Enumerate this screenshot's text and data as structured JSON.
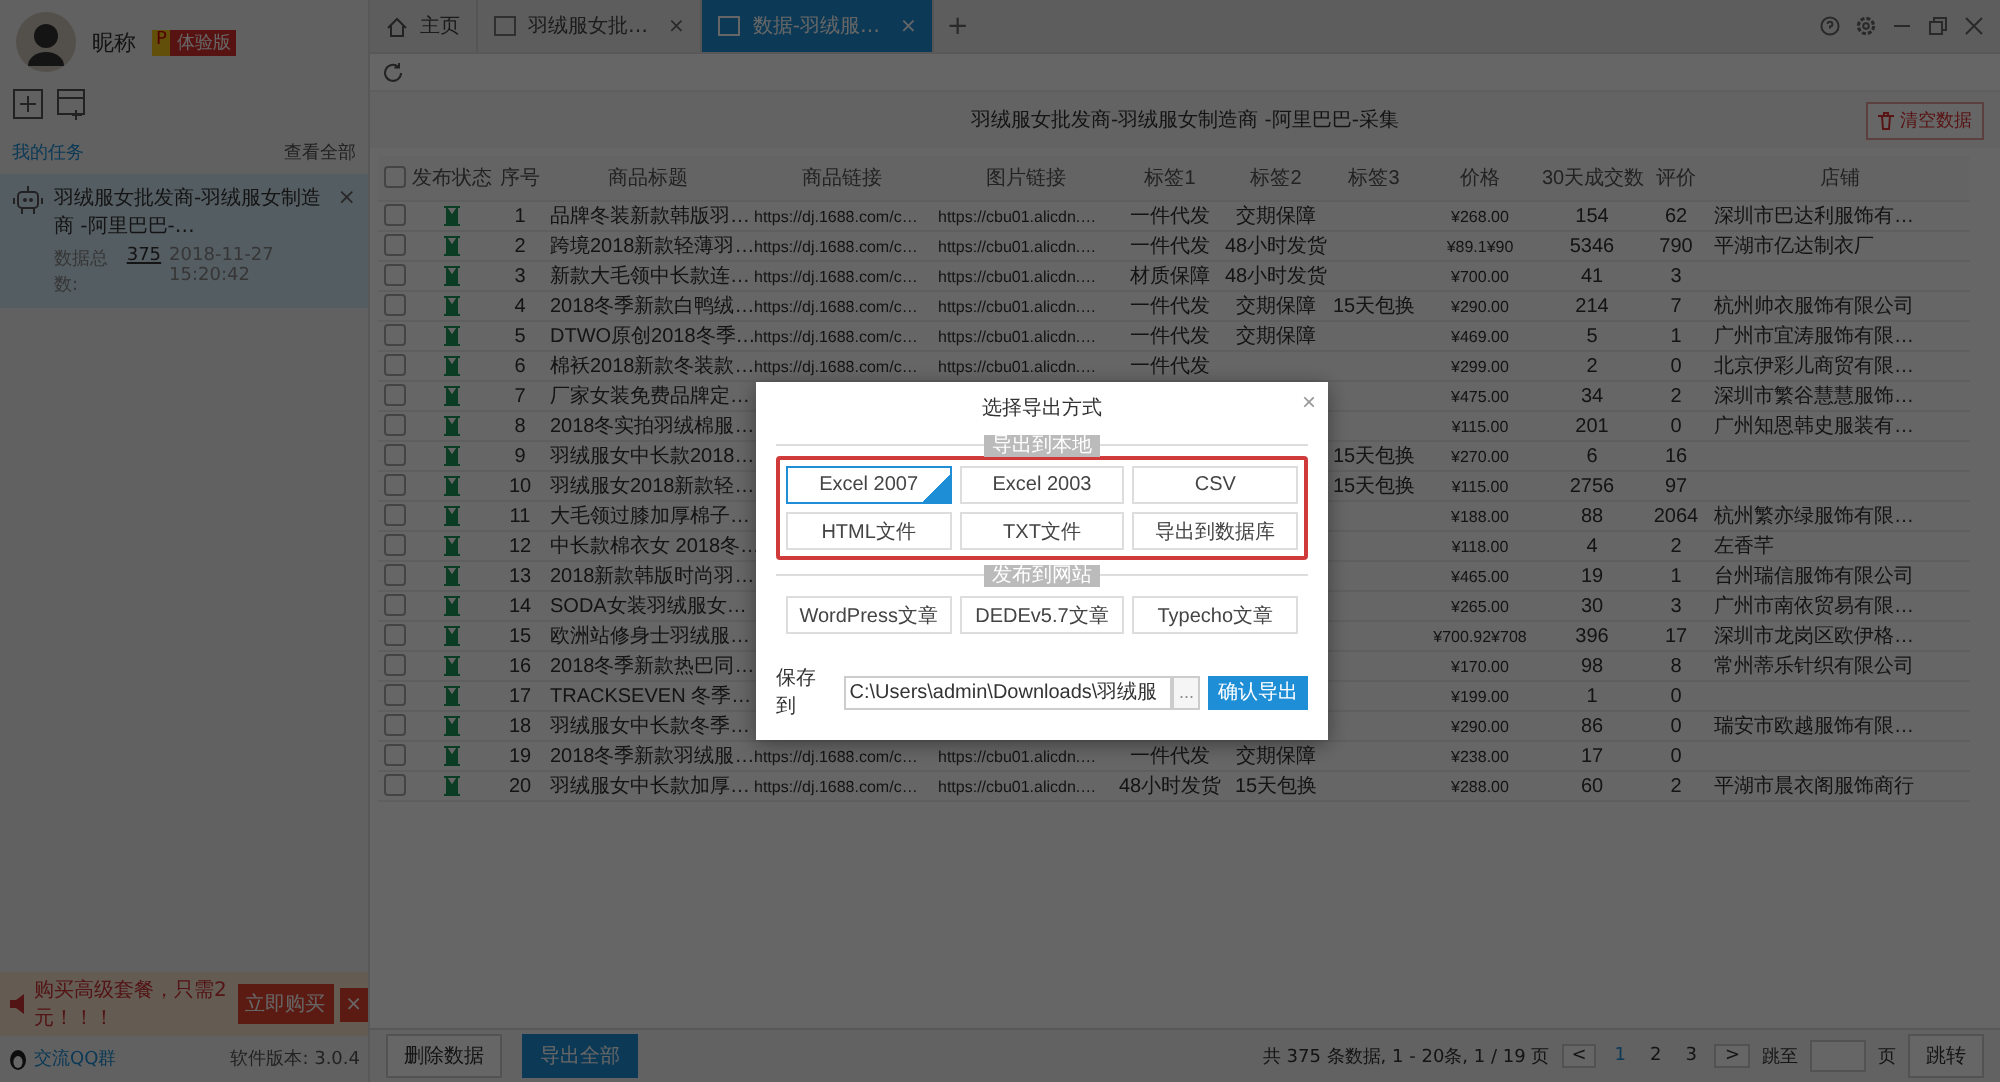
{
  "user": {
    "nickname": "昵称",
    "badge_letter": "P",
    "badge": "体验版"
  },
  "sidebar": {
    "section_title": "我的任务",
    "view_all": "查看全部",
    "tasks": [
      {
        "title": "羽绒服女批发商-羽绒服女制造商 -阿里巴巴-…",
        "count_label": "数据总数:",
        "count": "375",
        "time": "2018-11-27 15:20:42",
        "close": "×",
        "selected": true
      }
    ],
    "promo": {
      "text": "购买高级套餐，只需2元！！！",
      "button": "立即购买",
      "close": "×"
    },
    "qq_link": "交流QQ群",
    "version": "软件版本: 3.0.4"
  },
  "tabs": [
    {
      "kind": "home",
      "label": "主页",
      "selected": false
    },
    {
      "kind": "page",
      "label": "羽绒服女批…",
      "close": "×",
      "selected": false
    },
    {
      "kind": "page",
      "label": "数据-羽绒服…",
      "close": "×",
      "selected": true
    }
  ],
  "add_tab": "+",
  "page": {
    "title": "羽绒服女批发商-羽绒服女制造商 -阿里巴巴-采集",
    "clear_button": "清空数据"
  },
  "table": {
    "all_checked": false,
    "columns": [
      "发布状态",
      "序号",
      "商品标题",
      "商品链接",
      "图片链接",
      "标签1",
      "标签2",
      "标签3",
      "价格",
      "30天成交数",
      "评价",
      "店铺"
    ],
    "rows": [
      {
        "checked": false,
        "index": "1",
        "title": "品牌冬装新款韩版羽…",
        "link": "https://dj.1688.com/c…",
        "image": "https://cbu01.alicdn.…",
        "tag1": "一件代发",
        "tag2": "交期保障",
        "price": "¥268.00",
        "sales": "154",
        "rating": "62",
        "shop": "深圳市巴达利服饰有…"
      },
      {
        "checked": false,
        "index": "2",
        "title": "跨境2018新款轻薄羽…",
        "link": "https://dj.1688.com/c…",
        "image": "https://cbu01.alicdn.…",
        "tag1": "一件代发",
        "tag2": "48小时发货",
        "price": "¥89.1¥90",
        "sales": "5346",
        "rating": "790",
        "shop": "平湖市亿达制衣厂"
      },
      {
        "checked": false,
        "index": "3",
        "title": "新款大毛领中长款连…",
        "link": "https://dj.1688.com/c…",
        "image": "https://cbu01.alicdn.…",
        "tag1": "材质保障",
        "tag2": "48小时发货",
        "price": "¥700.00",
        "sales": "41",
        "rating": "3"
      },
      {
        "checked": false,
        "index": "4",
        "title": "2018冬季新款白鸭绒…",
        "link": "https://dj.1688.com/c…",
        "image": "https://cbu01.alicdn.…",
        "tag1": "一件代发",
        "tag2": "交期保障",
        "tag3": "15天包换",
        "price": "¥290.00",
        "sales": "214",
        "rating": "7",
        "shop": "杭州帅衣服饰有限公司"
      },
      {
        "checked": false,
        "index": "5",
        "title": "DTWO原创2018冬季…",
        "link": "https://dj.1688.com/c…",
        "image": "https://cbu01.alicdn.…",
        "tag1": "一件代发",
        "tag2": "交期保障",
        "price": "¥469.00",
        "sales": "5",
        "rating": "1",
        "shop": "广州市宜涛服饰有限…"
      },
      {
        "checked": false,
        "index": "6",
        "title": "棉袄2018新款冬装款…",
        "link": "https://dj.1688.com/c…",
        "image": "https://cbu01.alicdn.…",
        "tag1": "一件代发",
        "price": "¥299.00",
        "sales": "2",
        "rating": "0",
        "shop": "北京伊彩儿商贸有限…"
      },
      {
        "checked": false,
        "index": "7",
        "title": "厂家女装免费品牌定…",
        "price": "¥475.00",
        "sales": "34",
        "rating": "2",
        "shop": "深圳市繁谷慧慧服饰…"
      },
      {
        "checked": false,
        "index": "8",
        "title": "2018冬实拍羽绒棉服…",
        "price": "¥115.00",
        "sales": "201",
        "rating": "0",
        "shop": "广州知恩韩史服装有…"
      },
      {
        "checked": false,
        "index": "9",
        "title": "羽绒服女中长款2018…",
        "tag3": "15天包换",
        "price": "¥270.00",
        "sales": "6",
        "rating": "16"
      },
      {
        "checked": false,
        "index": "10",
        "title": "羽绒服女2018新款轻…",
        "tag3": "15天包换",
        "price": "¥115.00",
        "sales": "2756",
        "rating": "97"
      },
      {
        "checked": false,
        "index": "11",
        "title": "大毛领过膝加厚棉子…",
        "price": "¥188.00",
        "sales": "88",
        "rating": "2064",
        "shop": "杭州繁亦绿服饰有限…"
      },
      {
        "checked": false,
        "index": "12",
        "title": "中长款棉衣女 2018冬…",
        "price": "¥118.00",
        "sales": "4",
        "rating": "2",
        "shop": "左香芊"
      },
      {
        "checked": false,
        "index": "13",
        "title": "2018新款韩版时尚羽…",
        "price": "¥465.00",
        "sales": "19",
        "rating": "1",
        "shop": "台州瑞信服饰有限公司"
      },
      {
        "checked": false,
        "index": "14",
        "title": "SODA女装羽绒服女…",
        "price": "¥265.00",
        "sales": "30",
        "rating": "3",
        "shop": "广州市南依贸易有限…"
      },
      {
        "checked": false,
        "index": "15",
        "title": "欧洲站修身士羽绒服…",
        "price": "¥700.92¥708",
        "sales": "396",
        "rating": "17",
        "shop": "深圳市龙岗区欧伊格…"
      },
      {
        "checked": false,
        "index": "16",
        "title": "2018冬季新款热巴同…",
        "price": "¥170.00",
        "sales": "98",
        "rating": "8",
        "shop": "常州蒂乐针织有限公司"
      },
      {
        "checked": false,
        "index": "17",
        "title": "TRACKSEVEN 冬季…",
        "price": "¥199.00",
        "sales": "1",
        "rating": "0"
      },
      {
        "checked": false,
        "index": "18",
        "title": "羽绒服女中长款冬季…",
        "price": "¥290.00",
        "sales": "86",
        "rating": "0",
        "shop": "瑞安市欧越服饰有限…"
      },
      {
        "checked": false,
        "index": "19",
        "title": "2018冬季新款羽绒服…",
        "link": "https://dj.1688.com/c…",
        "image": "https://cbu01.alicdn.…",
        "tag1": "一件代发",
        "tag2": "交期保障",
        "price": "¥238.00",
        "sales": "17",
        "rating": "0"
      },
      {
        "checked": false,
        "index": "20",
        "title": "羽绒服女中长款加厚…",
        "link": "https://dj.1688.com/c…",
        "image": "https://cbu01.alicdn.…",
        "tag1": "48小时发货",
        "tag2": "15天包换",
        "price": "¥288.00",
        "sales": "60",
        "rating": "2",
        "shop": "平湖市晨衣阁服饰商行"
      }
    ]
  },
  "footer_buttons": [
    {
      "label": "删除数据",
      "kind": "default"
    },
    {
      "label": "导出全部",
      "kind": "primary"
    }
  ],
  "pagination": {
    "summary": "共 375 条数据, 1 - 20条, 1 / 19 页",
    "prev": "<",
    "pages": [
      {
        "label": "1",
        "selected": true
      },
      {
        "label": "2",
        "selected": false
      },
      {
        "label": "3",
        "selected": false
      }
    ],
    "next": ">",
    "goto_label": "跳至",
    "page_suffix": "页",
    "goto_button": "跳转"
  },
  "dialog": {
    "title": "选择导出方式",
    "close": "×",
    "sections": [
      {
        "label": "导出到本地",
        "highlighted": true,
        "options": [
          {
            "label": "Excel 2007",
            "selected": true
          },
          {
            "label": "Excel 2003",
            "selected": false
          },
          {
            "label": "CSV",
            "selected": false
          },
          {
            "label": "HTML文件",
            "selected": false
          },
          {
            "label": "TXT文件",
            "selected": false
          },
          {
            "label": "导出到数据库",
            "selected": false
          }
        ]
      },
      {
        "label": "发布到网站",
        "highlighted": false,
        "options": [
          {
            "label": "WordPress文章",
            "selected": false
          },
          {
            "label": "DEDEv5.7文章",
            "selected": false
          },
          {
            "label": "Typecho文章",
            "selected": false
          }
        ]
      }
    ],
    "save_label": "保存到",
    "path": "C:\\Users\\admin\\Downloads\\羽绒服",
    "browse": "...",
    "confirm": "确认导出"
  }
}
